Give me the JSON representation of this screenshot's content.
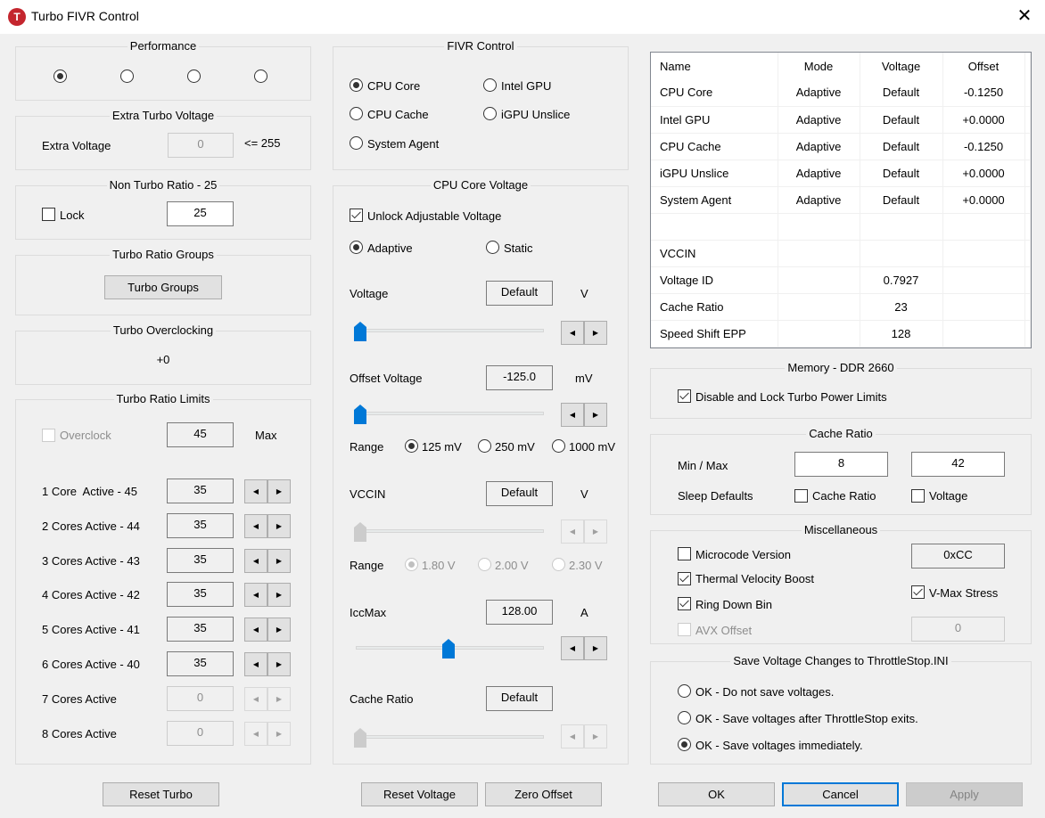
{
  "window": {
    "title": "Turbo FIVR Control",
    "app_icon_glyph": "T",
    "close_glyph": "✕"
  },
  "performance": {
    "title": "Performance",
    "options_checked": [
      true,
      false,
      false,
      false
    ]
  },
  "extra_turbo_voltage": {
    "title": "Extra Turbo Voltage",
    "label": "Extra Voltage",
    "value": "0",
    "limit": "<= 255"
  },
  "non_turbo_ratio": {
    "title": "Non Turbo Ratio - 25",
    "lock_label": "Lock",
    "lock_checked": false,
    "value": "25"
  },
  "turbo_ratio_groups": {
    "title": "Turbo Ratio Groups",
    "button": "Turbo Groups"
  },
  "turbo_overclocking": {
    "title": "Turbo Overclocking",
    "value": "+0"
  },
  "turbo_ratio_limits": {
    "title": "Turbo Ratio Limits",
    "overclock_label": "Overclock",
    "overclock_checked": false,
    "max_value": "45",
    "max_label": "Max",
    "rows": [
      {
        "label": "1 Core  Active - 45",
        "value": "35",
        "enabled": true
      },
      {
        "label": "2 Cores Active - 44",
        "value": "35",
        "enabled": true
      },
      {
        "label": "3 Cores Active - 43",
        "value": "35",
        "enabled": true
      },
      {
        "label": "4 Cores Active - 42",
        "value": "35",
        "enabled": true
      },
      {
        "label": "5 Cores Active - 41",
        "value": "35",
        "enabled": true
      },
      {
        "label": "6 Cores Active - 40",
        "value": "35",
        "enabled": true
      },
      {
        "label": "7 Cores Active",
        "value": "0",
        "enabled": false
      },
      {
        "label": "8 Cores Active",
        "value": "0",
        "enabled": false
      }
    ],
    "reset_button": "Reset Turbo"
  },
  "fivr_control": {
    "title": "FIVR Control",
    "options": [
      {
        "label": "CPU Core",
        "checked": true
      },
      {
        "label": "Intel GPU",
        "checked": false
      },
      {
        "label": "CPU Cache",
        "checked": false
      },
      {
        "label": "iGPU Unslice",
        "checked": false
      },
      {
        "label": "System Agent",
        "checked": false
      }
    ]
  },
  "cpu_core_voltage": {
    "title": "CPU Core Voltage",
    "unlock_label": "Unlock Adjustable Voltage",
    "unlock_checked": true,
    "adaptive_label": "Adaptive",
    "static_label": "Static",
    "mode": "Adaptive",
    "voltage": {
      "label": "Voltage",
      "value": "Default",
      "unit": "V",
      "slider_fraction": 0.0
    },
    "offset": {
      "label": "Offset Voltage",
      "value": "-125.0",
      "unit": "mV",
      "slider_fraction": 0.0
    },
    "offset_range": {
      "label": "Range",
      "options": [
        "125 mV",
        "250 mV",
        "1000 mV"
      ],
      "selected": "125 mV"
    },
    "vccin": {
      "label": "VCCIN",
      "value": "Default",
      "unit": "V",
      "slider_fraction": 0.0
    },
    "vccin_range": {
      "label": "Range",
      "options": [
        "1.80 V",
        "2.00 V",
        "2.30 V"
      ],
      "selected": "1.80 V"
    },
    "iccmax": {
      "label": "IccMax",
      "value": "128.00",
      "unit": "A",
      "slider_fraction": 0.5
    },
    "cache_ratio": {
      "label": "Cache Ratio",
      "value": "Default",
      "slider_fraction": 0.0
    },
    "reset_button": "Reset Voltage",
    "zero_button": "Zero Offset"
  },
  "status_table": {
    "columns": [
      "Name",
      "Mode",
      "Voltage",
      "Offset"
    ],
    "rows": [
      [
        "CPU Core",
        "Adaptive",
        "Default",
        "-0.1250"
      ],
      [
        "Intel GPU",
        "Adaptive",
        "Default",
        "+0.0000"
      ],
      [
        "CPU Cache",
        "Adaptive",
        "Default",
        "-0.1250"
      ],
      [
        "iGPU Unslice",
        "Adaptive",
        "Default",
        "+0.0000"
      ],
      [
        "System Agent",
        "Adaptive",
        "Default",
        "+0.0000"
      ],
      [
        "",
        "",
        "",
        ""
      ],
      [
        "VCCIN",
        "",
        "",
        ""
      ],
      [
        "Voltage ID",
        "",
        "0.7927",
        ""
      ],
      [
        "Cache Ratio",
        "",
        "23",
        ""
      ],
      [
        "Speed Shift EPP",
        "",
        "128",
        ""
      ]
    ]
  },
  "memory": {
    "title": "Memory - DDR 2660",
    "disable_lock_label": "Disable and Lock Turbo Power Limits",
    "disable_lock_checked": true
  },
  "cache_ratio": {
    "title": "Cache Ratio",
    "minmax_label": "Min / Max",
    "min": "8",
    "max": "42",
    "sleep_label": "Sleep Defaults",
    "sleep_cache_label": "Cache Ratio",
    "sleep_cache_checked": false,
    "sleep_voltage_label": "Voltage",
    "sleep_voltage_checked": false
  },
  "misc": {
    "title": "Miscellaneous",
    "microcode_label": "Microcode Version",
    "microcode_checked": false,
    "microcode_value": "0xCC",
    "tvb_label": "Thermal Velocity Boost",
    "tvb_checked": true,
    "ring_label": "Ring Down Bin",
    "ring_checked": true,
    "avx_label": "AVX Offset",
    "avx_checked": false,
    "avx_value": "0",
    "vmax_label": "V-Max Stress",
    "vmax_checked": true
  },
  "save": {
    "title": "Save Voltage Changes to ThrottleStop.INI",
    "options": [
      {
        "label": "OK - Do not save voltages.",
        "checked": false
      },
      {
        "label": "OK - Save voltages after ThrottleStop exits.",
        "checked": false
      },
      {
        "label": "OK - Save voltages immediately.",
        "checked": true
      }
    ]
  },
  "dialog_buttons": {
    "ok": "OK",
    "cancel": "Cancel",
    "apply": "Apply"
  },
  "colors": {
    "accent": "#0078d7",
    "slider_thumb": "#0078d7",
    "slider_thumb_disabled": "#cccccc",
    "app_icon": "#c4262e"
  }
}
